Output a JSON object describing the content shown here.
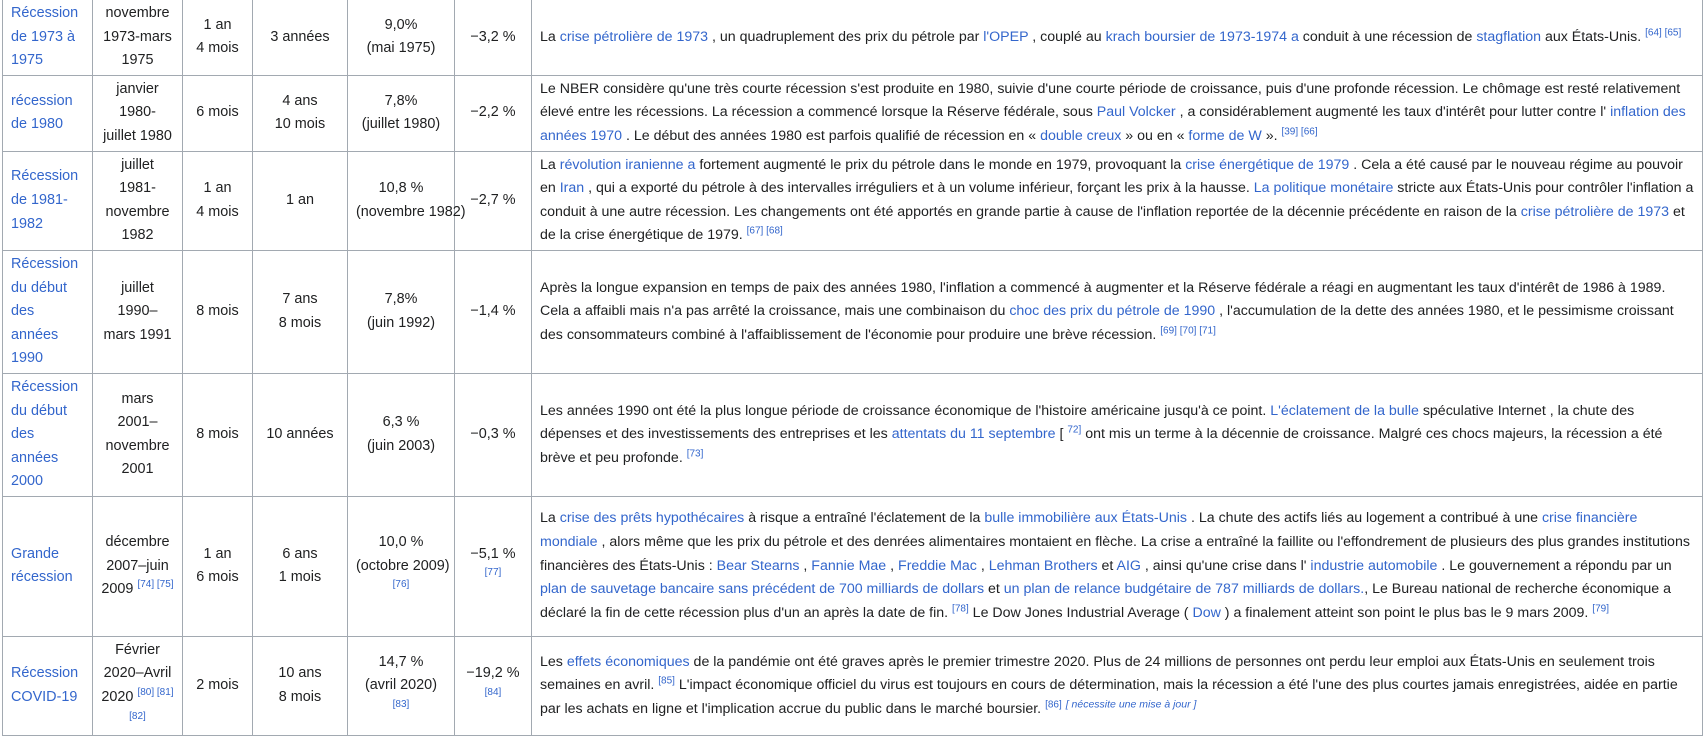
{
  "rows": [
    {
      "name": [
        "Récession",
        "de 1973 à",
        "1975"
      ],
      "dates": [
        "novembre",
        "1973-mars",
        "1975"
      ],
      "dates_refs": "",
      "duration": [
        "1 an",
        "4 mois"
      ],
      "since_previous": [
        "3 années"
      ],
      "peak_unemployment": "9,0%",
      "peak_date": "(mai 1975)",
      "peak_refs": "",
      "gdp": "−3,2 %",
      "gdp_refs": "",
      "desc": [
        {
          "t": "La "
        },
        {
          "a": "crise pétrolière de 1973"
        },
        {
          "t": " , un quadruplement des prix du pétrole par "
        },
        {
          "a": "l'OPEP"
        },
        {
          "t": " , couplé au "
        },
        {
          "a": "krach boursier de 1973-1974 a"
        },
        {
          "t": " conduit à une récession de "
        },
        {
          "a": "stagflation"
        },
        {
          "t": " aux États-Unis. "
        },
        {
          "s": "[64] [65]"
        }
      ]
    },
    {
      "name": [
        "récession",
        "de 1980"
      ],
      "dates": [
        "janvier 1980-",
        "juillet 1980"
      ],
      "dates_refs": "",
      "duration": [
        "6 mois"
      ],
      "since_previous": [
        "4 ans",
        "10 mois"
      ],
      "peak_unemployment": "7,8%",
      "peak_date": "(juillet 1980)",
      "peak_refs": "",
      "gdp": "−2,2 %",
      "gdp_refs": "",
      "desc": [
        {
          "t": "Le NBER considère qu'une très courte récession s'est produite en 1980, suivie d'une courte période de croissance, puis d'une profonde récession. Le chômage est resté relativement élevé entre les récessions. La récession a commencé lorsque la Réserve fédérale, sous "
        },
        {
          "a": "Paul Volcker"
        },
        {
          "t": " , a considérablement augmenté les taux d'intérêt pour lutter contre l' "
        },
        {
          "a": "inflation des années 1970"
        },
        {
          "t": " . Le début des années 1980 est parfois qualifié de récession en « "
        },
        {
          "a": "double creux"
        },
        {
          "t": " » ou en « "
        },
        {
          "a": "forme de W"
        },
        {
          "t": " ». "
        },
        {
          "s": "[39] [66]"
        }
      ]
    },
    {
      "name": [
        "Récession",
        "de 1981-",
        "1982"
      ],
      "dates": [
        "juillet 1981-",
        "novembre",
        "1982"
      ],
      "dates_refs": "",
      "duration": [
        "1 an",
        "4 mois"
      ],
      "since_previous": [
        "1 an"
      ],
      "peak_unemployment": "10,8 %",
      "peak_date": "(novembre 1982)",
      "peak_refs": "",
      "gdp": "−2,7 %",
      "gdp_refs": "",
      "desc": [
        {
          "t": "La "
        },
        {
          "a": "révolution iranienne a"
        },
        {
          "t": " fortement augmenté le prix du pétrole dans le monde en 1979, provoquant la "
        },
        {
          "a": "crise énergétique de 1979"
        },
        {
          "t": " . Cela a été causé par le nouveau régime au pouvoir en "
        },
        {
          "a": "Iran"
        },
        {
          "t": " , qui a exporté du pétrole à des intervalles irréguliers et à un volume inférieur, forçant les prix à la hausse. "
        },
        {
          "a": "La politique monétaire"
        },
        {
          "t": " stricte aux États-Unis pour contrôler l'inflation a conduit à une autre récession. Les changements ont été apportés en grande partie à cause de l'inflation reportée de la décennie précédente en raison de la "
        },
        {
          "a": "crise pétrolière de 1973"
        },
        {
          "t": " et de la crise énergétique de 1979. "
        },
        {
          "s": "[67] [68]"
        }
      ]
    },
    {
      "name": [
        "Récession",
        "du début",
        "des années",
        "1990"
      ],
      "dates": [
        "juillet 1990–",
        "mars 1991"
      ],
      "dates_refs": "",
      "duration": [
        "8 mois"
      ],
      "since_previous": [
        "7 ans",
        "8 mois"
      ],
      "peak_unemployment": "7,8%",
      "peak_date": "(juin 1992)",
      "peak_refs": "",
      "gdp": "−1,4 %",
      "gdp_refs": "",
      "desc": [
        {
          "t": "Après la longue expansion en temps de paix des années 1980, l'inflation a commencé à augmenter et la Réserve fédérale a réagi en augmentant les taux d'intérêt de 1986 à 1989. Cela a affaibli mais n'a pas arrêté la croissance, mais une combinaison du "
        },
        {
          "a": "choc des prix du pétrole de 1990"
        },
        {
          "t": " , l'accumulation de la dette des années 1980, et le pessimisme croissant des consommateurs combiné à l'affaiblissement de l'économie pour produire une brève récession. "
        },
        {
          "s": "[69] [70] [71]"
        }
      ]
    },
    {
      "name": [
        "Récession",
        "du début",
        "des années",
        "2000"
      ],
      "dates": [
        "mars 2001–",
        "novembre",
        "2001"
      ],
      "dates_refs": "",
      "duration": [
        "8 mois"
      ],
      "since_previous": [
        "10 années"
      ],
      "peak_unemployment": "6,3 %",
      "peak_date": "(juin 2003)",
      "peak_refs": "",
      "gdp": "−0,3 %",
      "gdp_refs": "",
      "desc": [
        {
          "t": "Les années 1990 ont été la plus longue période de croissance économique de l'histoire américaine jusqu'à ce point. "
        },
        {
          "a": "L'éclatement de la bulle"
        },
        {
          "t": " spéculative Internet , la chute des dépenses et des investissements des entreprises et les "
        },
        {
          "a": "attentats du 11 septembre"
        },
        {
          "t": " [ "
        },
        {
          "s": "72]"
        },
        {
          "t": " ont mis un terme à la décennie de croissance. Malgré ces chocs majeurs, la récession a été brève et peu profonde. "
        },
        {
          "s": "[73]"
        }
      ]
    },
    {
      "name": [
        "Grande",
        "récession"
      ],
      "dates": [
        "décembre",
        "2007–juin",
        "2009"
      ],
      "dates_refs": "[74] [75]",
      "duration": [
        "1 an",
        "6 mois"
      ],
      "since_previous": [
        "6 ans",
        "1 mois"
      ],
      "peak_unemployment": "10,0 %",
      "peak_date": "(octobre 2009)",
      "peak_refs": "[76]",
      "gdp": "−5,1 %",
      "gdp_refs": "[77]",
      "desc": [
        {
          "t": "La "
        },
        {
          "a": "crise des prêts hypothécaires"
        },
        {
          "t": " à risque a entraîné l'éclatement de la "
        },
        {
          "a": "bulle immobilière aux États-Unis"
        },
        {
          "t": " . La chute des actifs liés au logement a contribué à une "
        },
        {
          "a": "crise financière mondiale"
        },
        {
          "t": " , alors même que les prix du pétrole et des denrées alimentaires montaient en flèche. La crise a entraîné la faillite ou l'effondrement de plusieurs des plus grandes institutions financières des États-Unis : "
        },
        {
          "a": "Bear Stearns"
        },
        {
          "t": " , "
        },
        {
          "a": "Fannie Mae"
        },
        {
          "t": " , "
        },
        {
          "a": "Freddie Mac"
        },
        {
          "t": " , "
        },
        {
          "a": "Lehman Brothers"
        },
        {
          "t": " et "
        },
        {
          "a": "AIG"
        },
        {
          "t": " , ainsi qu'une crise dans l' "
        },
        {
          "a": "industrie automobile"
        },
        {
          "t": " . Le gouvernement a répondu par un "
        },
        {
          "a": "plan de sauvetage bancaire sans précédent de 700 milliards de dollars"
        },
        {
          "t": " et "
        },
        {
          "a": "un plan de relance budgétaire de 787 milliards de dollars."
        },
        {
          "t": ", Le Bureau national de recherche économique a déclaré la fin de cette récession plus d'un an après la date de fin. "
        },
        {
          "s": "[78]"
        },
        {
          "t": " Le Dow Jones Industrial Average ( "
        },
        {
          "a": "Dow"
        },
        {
          "t": " ) a finalement atteint son point le plus bas le 9 mars 2009. "
        },
        {
          "s": "[79]"
        }
      ]
    },
    {
      "name": [
        "Récession",
        "COVID-19"
      ],
      "dates": [
        "Février",
        "2020–Avril",
        "2020"
      ],
      "dates_refs": "[80] [81] [82]",
      "duration": [
        "2 mois"
      ],
      "since_previous": [
        "10 ans",
        "8 mois"
      ],
      "peak_unemployment": "14,7 %",
      "peak_date": "(avril 2020)",
      "peak_refs": "[83]",
      "gdp": "−19,2 %",
      "gdp_refs": "[84]",
      "desc": [
        {
          "t": "Les "
        },
        {
          "a": "effets économiques"
        },
        {
          "t": " de la pandémie ont été graves après le premier trimestre 2020. Plus de 24 millions de personnes ont perdu leur emploi aux États-Unis en seulement trois semaines en avril. "
        },
        {
          "s": "[85]"
        },
        {
          "t": " L'impact économique officiel du virus est toujours en cours de détermination, mais la récession a été l'une des plus courtes jamais enregistrées, aidée en partie par les achats en ligne et l'implication accrue du public dans le marché boursier. "
        },
        {
          "s": "[86]"
        },
        {
          "t": " "
        },
        {
          "n": "[ nécessite une mise à jour ]"
        }
      ]
    }
  ],
  "colors": {
    "link": "#3366cc",
    "border": "#a2a9b1",
    "text": "#202122"
  }
}
